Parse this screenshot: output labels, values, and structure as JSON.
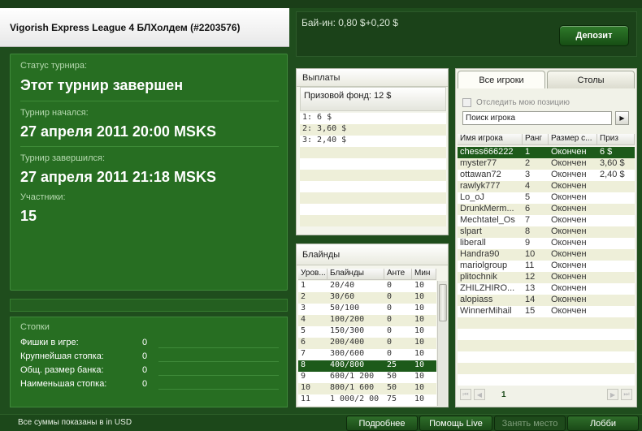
{
  "header": {
    "title": "Vigorish Express League 4 БЛХолдем (#2203576)",
    "buyin": "Бай-ин: 0,80 $+0,20 $",
    "deposit_label": "Депозит"
  },
  "status": {
    "status_label": "Статус турнира:",
    "status_value": "Этот турнир завершен",
    "started_label": "Турнир начался:",
    "started_value": "27 апреля 2011  20:00 MSKS",
    "ended_label": "Турнир завершился:",
    "ended_value": "27 апреля 2011  21:18 MSKS",
    "participants_label": "Участники:",
    "participants_value": "15"
  },
  "stacks": {
    "title": "Стопки",
    "rows": [
      {
        "label": "Фишки в игре:",
        "value": "0"
      },
      {
        "label": "Крупнейшая стопка:",
        "value": "0"
      },
      {
        "label": "Общ. размер банка:",
        "value": "0"
      },
      {
        "label": "Наименьшая стопка:",
        "value": "0"
      }
    ]
  },
  "payouts": {
    "title": "Выплаты",
    "prize_fund": "Призовой фонд: 12 $",
    "rows": [
      "1: 6 $",
      "2: 3,60 $",
      "3: 2,40 $"
    ]
  },
  "blinds": {
    "title": "Блайнды",
    "columns": [
      "Уров...",
      "Блайнды",
      "Анте",
      "Мин"
    ],
    "rows": [
      [
        "1",
        "20/40",
        "0",
        "10"
      ],
      [
        "2",
        "30/60",
        "0",
        "10"
      ],
      [
        "3",
        "50/100",
        "0",
        "10"
      ],
      [
        "4",
        "100/200",
        "0",
        "10"
      ],
      [
        "5",
        "150/300",
        "0",
        "10"
      ],
      [
        "6",
        "200/400",
        "0",
        "10"
      ],
      [
        "7",
        "300/600",
        "0",
        "10"
      ],
      [
        "8",
        "400/800",
        "25",
        "10"
      ],
      [
        "9",
        "600/1 200",
        "50",
        "10"
      ],
      [
        "10",
        "800/1 600",
        "50",
        "10"
      ],
      [
        "11",
        "1 000/2 00",
        "75",
        "10"
      ]
    ],
    "selected_index": 7
  },
  "players": {
    "tab_all": "Все игроки",
    "tab_tables": "Столы",
    "track_label": "Отследить мою позицию",
    "search_placeholder": "Поиск игрока",
    "columns": [
      "Имя игрока",
      "Ранг",
      "Размер с...",
      "Приз"
    ],
    "rows": [
      [
        "chess666222",
        "1",
        "Окончен",
        "6 $"
      ],
      [
        "myster77",
        "2",
        "Окончен",
        "3,60 $"
      ],
      [
        "ottawan72",
        "3",
        "Окончен",
        "2,40 $"
      ],
      [
        "rawlyk777",
        "4",
        "Окончен",
        ""
      ],
      [
        "Lo_oJ",
        "5",
        "Окончен",
        ""
      ],
      [
        "DrunkMerm...",
        "6",
        "Окончен",
        ""
      ],
      [
        "Mechtatel_Os",
        "7",
        "Окончен",
        ""
      ],
      [
        "slpart",
        "8",
        "Окончен",
        ""
      ],
      [
        "liberall",
        "9",
        "Окончен",
        ""
      ],
      [
        "Handra90",
        "10",
        "Окончен",
        ""
      ],
      [
        "mariolgroup",
        "11",
        "Окончен",
        ""
      ],
      [
        "plitochnik",
        "12",
        "Окончен",
        ""
      ],
      [
        "ZHILZHIRO...",
        "13",
        "Окончен",
        ""
      ],
      [
        "alopiass",
        "14",
        "Окончен",
        ""
      ],
      [
        "WinnerMihail",
        "15",
        "Окончен",
        ""
      ]
    ],
    "selected_index": 0,
    "page": "1"
  },
  "footer": {
    "note": "Все суммы показаны в in USD",
    "more_label": "Подробнее",
    "help_label": "Помощь Live",
    "seat_label": "Занять место",
    "lobby_label": "Лобби"
  },
  "colors": {
    "background": "#1f4d1d",
    "panel_green": "#276e22",
    "selected_row": "#1d5a1a"
  }
}
